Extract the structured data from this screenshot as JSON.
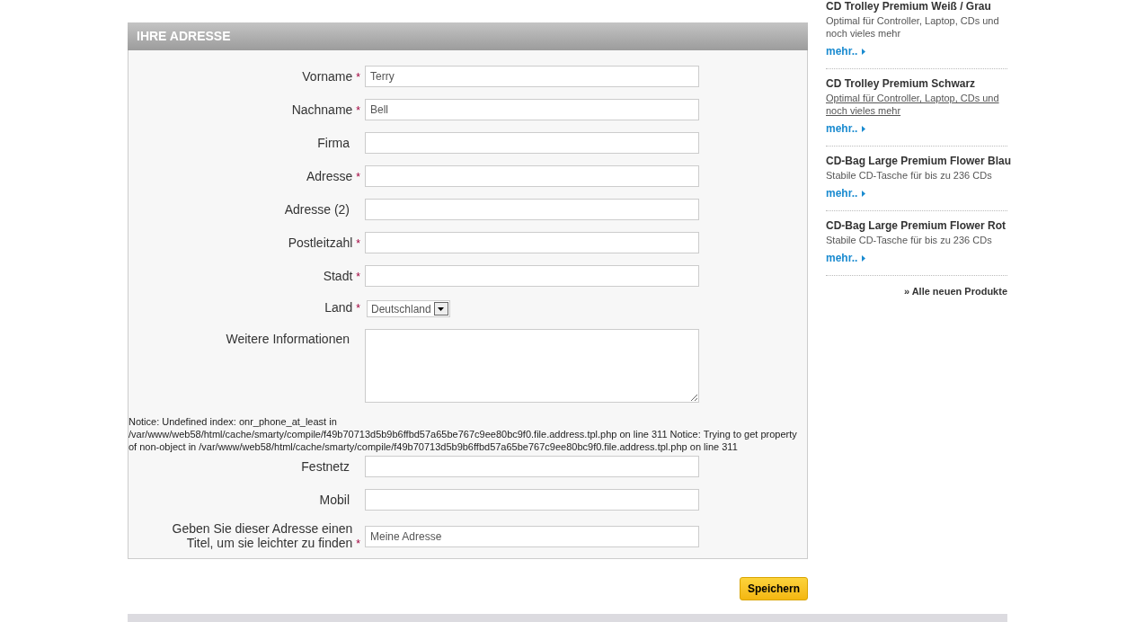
{
  "form": {
    "title": "IHRE ADRESSE",
    "rows": [
      {
        "kind": "text",
        "label": "Vorname",
        "required_mark": "*",
        "value": "Terry"
      },
      {
        "kind": "text",
        "label": "Nachname",
        "required_mark": "*",
        "value": "Bell"
      },
      {
        "kind": "text",
        "label": "Firma"
      },
      {
        "kind": "text",
        "label": "Adresse",
        "required_mark": "*"
      },
      {
        "kind": "text",
        "label": "Adresse (2)"
      },
      {
        "kind": "text",
        "label": "Postleitzahl",
        "required_mark": "*"
      },
      {
        "kind": "text",
        "label": "Stadt",
        "required_mark": "*"
      },
      {
        "kind": "select",
        "label": "Land",
        "required_mark": "*",
        "value": "Deutschland"
      },
      {
        "kind": "textarea",
        "label": "Weitere Informationen"
      },
      {
        "kind": "notice",
        "text": "Notice: Undefined index: onr_phone_at_least in /var/www/web58/html/cache/smarty/compile/f49b70713d5b9b6ffbd57a65be767c9ee80bc9f0.file.address.tpl.php on line 311 Notice: Trying to get property of non-object in /var/www/web58/html/cache/smarty/compile/f49b70713d5b9b6ffbd57a65be767c9ee80bc9f0.file.address.tpl.php on line 311"
      },
      {
        "kind": "text",
        "label": "Festnetz"
      },
      {
        "kind": "text",
        "label": "Mobil"
      },
      {
        "kind": "text",
        "label": "Geben Sie dieser Adresse einen Titel, um sie leichter zu finden",
        "required_mark": "*",
        "value": "Meine Adresse"
      }
    ],
    "submit": "Speichern"
  },
  "sidebar": {
    "products": [
      {
        "name": "CD Trolley Premium Weiß / Grau",
        "description": "Optimal für Controller, Laptop, CDs und noch vieles mehr",
        "hovered": false,
        "more": "mehr.."
      },
      {
        "name": "CD Trolley Premium Schwarz",
        "description": "Optimal für Controller, Laptop, CDs und noch vieles mehr",
        "hovered": true,
        "more": "mehr.."
      },
      {
        "name": "CD-Bag Large Premium Flower Blau",
        "description": "Stabile CD-Tasche für bis zu 236 CDs",
        "hovered": false,
        "more": "mehr.."
      },
      {
        "name": "CD-Bag Large Premium Flower Rot",
        "description": "Stabile CD-Tasche für bis zu 236 CDs",
        "hovered": false,
        "more": "mehr.."
      }
    ],
    "all_link": "» Alle neuen Produkte"
  }
}
